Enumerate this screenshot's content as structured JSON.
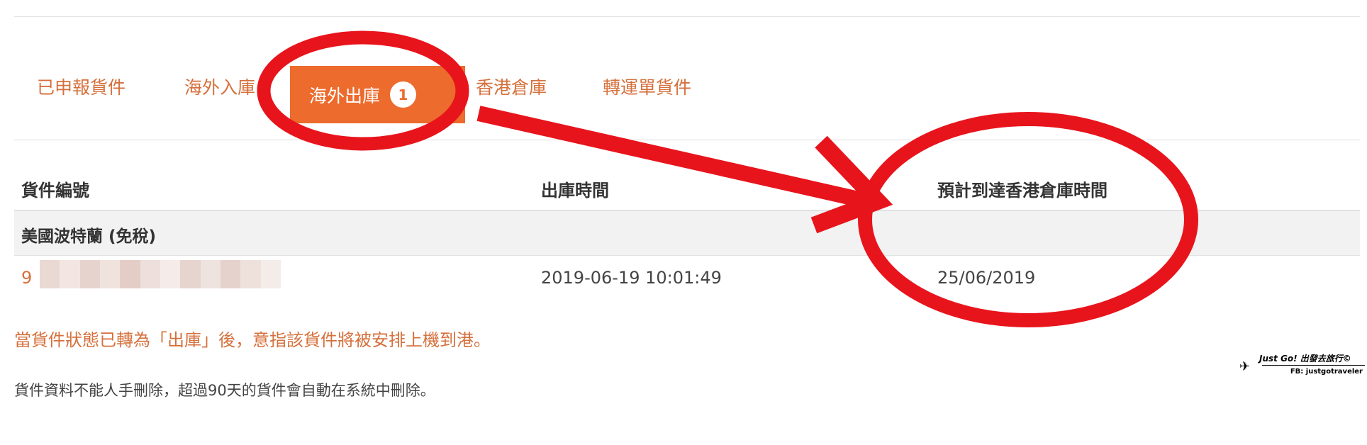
{
  "tabs": [
    {
      "label": "已申報貨件",
      "active": false
    },
    {
      "label": "海外入庫",
      "active": false
    },
    {
      "label": "海外出庫",
      "active": true,
      "badge": "1"
    },
    {
      "label": "香港倉庫",
      "active": false
    },
    {
      "label": "轉運單貨件",
      "active": false
    }
  ],
  "table": {
    "headers": [
      "貨件編號",
      "出庫時間",
      "預計到達香港倉庫時間"
    ],
    "group_label": "美國波特蘭 (免稅)",
    "rows": [
      {
        "id_visible": "9",
        "outbound_time": "2019-06-19 10:01:49",
        "eta": "25/06/2019"
      }
    ]
  },
  "notes": {
    "orange": "當貨件狀態已轉為「出庫」後，意指該貨件將被安排上機到港。",
    "gray": "貨件資料不能人手刪除，超過90天的貨件會自動在系統中刪除。"
  },
  "watermark": {
    "title": "Just Go! 出發去旅行©",
    "fb": "FB: justgotraveler"
  },
  "colors": {
    "accent": "#ec6b2d",
    "tab_text": "#d5703c",
    "annotation_red": "#e8141c"
  }
}
